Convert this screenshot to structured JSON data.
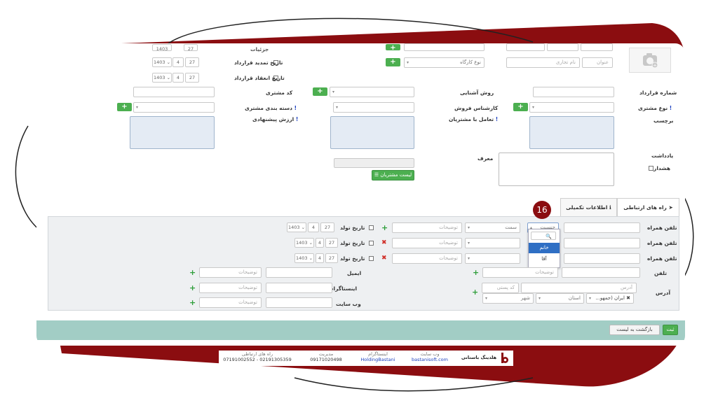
{
  "step_badge": "16",
  "top": {
    "partial_label_1": "جزئیات",
    "renewal_date_label": "تاریخ تمدید قرارداد",
    "contract_end_label": "تاریخ انعقاد قرارداد",
    "workshop_type_placeholder": "نوع کارگاه",
    "title_placeholder": "عنوان",
    "company_name_placeholder": "نام تجاری",
    "date_year": "1403",
    "date_month": "4",
    "date_day": "27"
  },
  "form": {
    "contract_number_label": "شماره قرارداد",
    "acquaintance_label": "روش آشنایی",
    "customer_code_label": "کد مشتری",
    "customer_type_label": "نوع مشتری",
    "sales_expert_label": "کارشناس فروش",
    "customer_category_label": "دسته بندی مشتری",
    "tags_label": "برچسب",
    "interaction_label": "تعامل با مشتریان",
    "proposed_value_label": "ارزش پیشنهادی",
    "note_label": "یادداشت",
    "warning_label": "هشدار",
    "referrer_label": "معرف",
    "customer_list_button": "لیست مشتریان",
    "required_mark": "!"
  },
  "tabs": [
    {
      "label": "راه های ارتباطی",
      "icon": "send-icon"
    },
    {
      "label": "اطلاعات تکمیلی",
      "icon": "info-icon"
    }
  ],
  "contacts": {
    "mobile_label": "تلفن همراه",
    "gender_placeholder": "جنسیت",
    "post_placeholder": "سمت",
    "desc_placeholder": "توضیحات",
    "birth_date_label": "تاریخ تولد",
    "phone_label": "تلفن",
    "email_label": "ایمیل",
    "instagram_label": "اینستاگرام",
    "website_label": "وب سایت",
    "address_label": "آدرس",
    "address_placeholder": "آدرس",
    "postal_code_placeholder": "کد پستی",
    "country_value": "ایران (جمهو...",
    "province_placeholder": "استان",
    "city_placeholder": "شهر",
    "date_year": "1403",
    "date_month": "4",
    "date_day": "27",
    "gender_options": [
      "خانم",
      "آقا"
    ]
  },
  "actions": {
    "submit_label": "ثبت",
    "back_label": "بازگشت به لیست"
  },
  "footer": {
    "brand": "هلدینگ باستانی",
    "website_key": "وب سایت",
    "website_val": "bastanisoft.com",
    "instagram_key": "اینستاگرام",
    "instagram_val": "HoldingBastani",
    "management_key": "مدیریت",
    "management_val": "09171020498",
    "contact_key": "راه های ارتباطی",
    "contact_val": "07191002552 - 02191305359"
  },
  "colors": {
    "frame": "#8b0d10",
    "badge": "#8b0d10",
    "accent_green": "#4caf50",
    "footer_bar": "#a2cdc5",
    "link_blue": "#1a3fbf"
  }
}
